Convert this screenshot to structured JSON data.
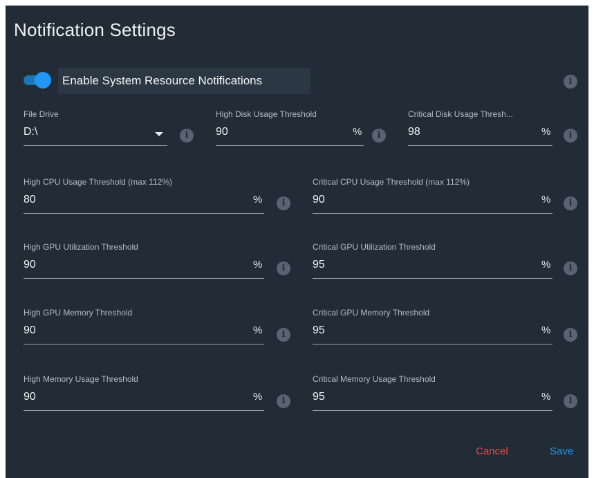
{
  "dialog": {
    "title": "Notification Settings"
  },
  "toggle": {
    "label": "Enable System Resource Notifications",
    "enabled": true,
    "accent_color": "#2196f3"
  },
  "info_icon": "i",
  "drive": {
    "label": "File Drive",
    "value": "D:\\"
  },
  "fields": {
    "high_disk": {
      "label": "High Disk Usage Threshold",
      "value": "90",
      "unit": "%"
    },
    "critical_disk": {
      "label": "Critical Disk Usage Thresh...",
      "value": "98",
      "unit": "%"
    },
    "high_cpu": {
      "label": "High CPU Usage Threshold (max 112%)",
      "value": "80",
      "unit": "%"
    },
    "critical_cpu": {
      "label": "Critical CPU Usage Threshold (max 112%)",
      "value": "90",
      "unit": "%"
    },
    "high_gpu_util": {
      "label": "High GPU Utilization Threshold",
      "value": "90",
      "unit": "%"
    },
    "critical_gpu_util": {
      "label": "Critical GPU Utilization Threshold",
      "value": "95",
      "unit": "%"
    },
    "high_gpu_mem": {
      "label": "High GPU Memory Threshold",
      "value": "90",
      "unit": "%"
    },
    "critical_gpu_mem": {
      "label": "Critical GPU Memory Threshold",
      "value": "95",
      "unit": "%"
    },
    "high_mem": {
      "label": "High Memory Usage Threshold",
      "value": "90",
      "unit": "%"
    },
    "critical_mem": {
      "label": "Critical Memory Usage Threshold",
      "value": "95",
      "unit": "%"
    }
  },
  "actions": {
    "cancel_label": "Cancel",
    "save_label": "Save",
    "cancel_color": "#e24b4b",
    "save_color": "#2196f3"
  }
}
